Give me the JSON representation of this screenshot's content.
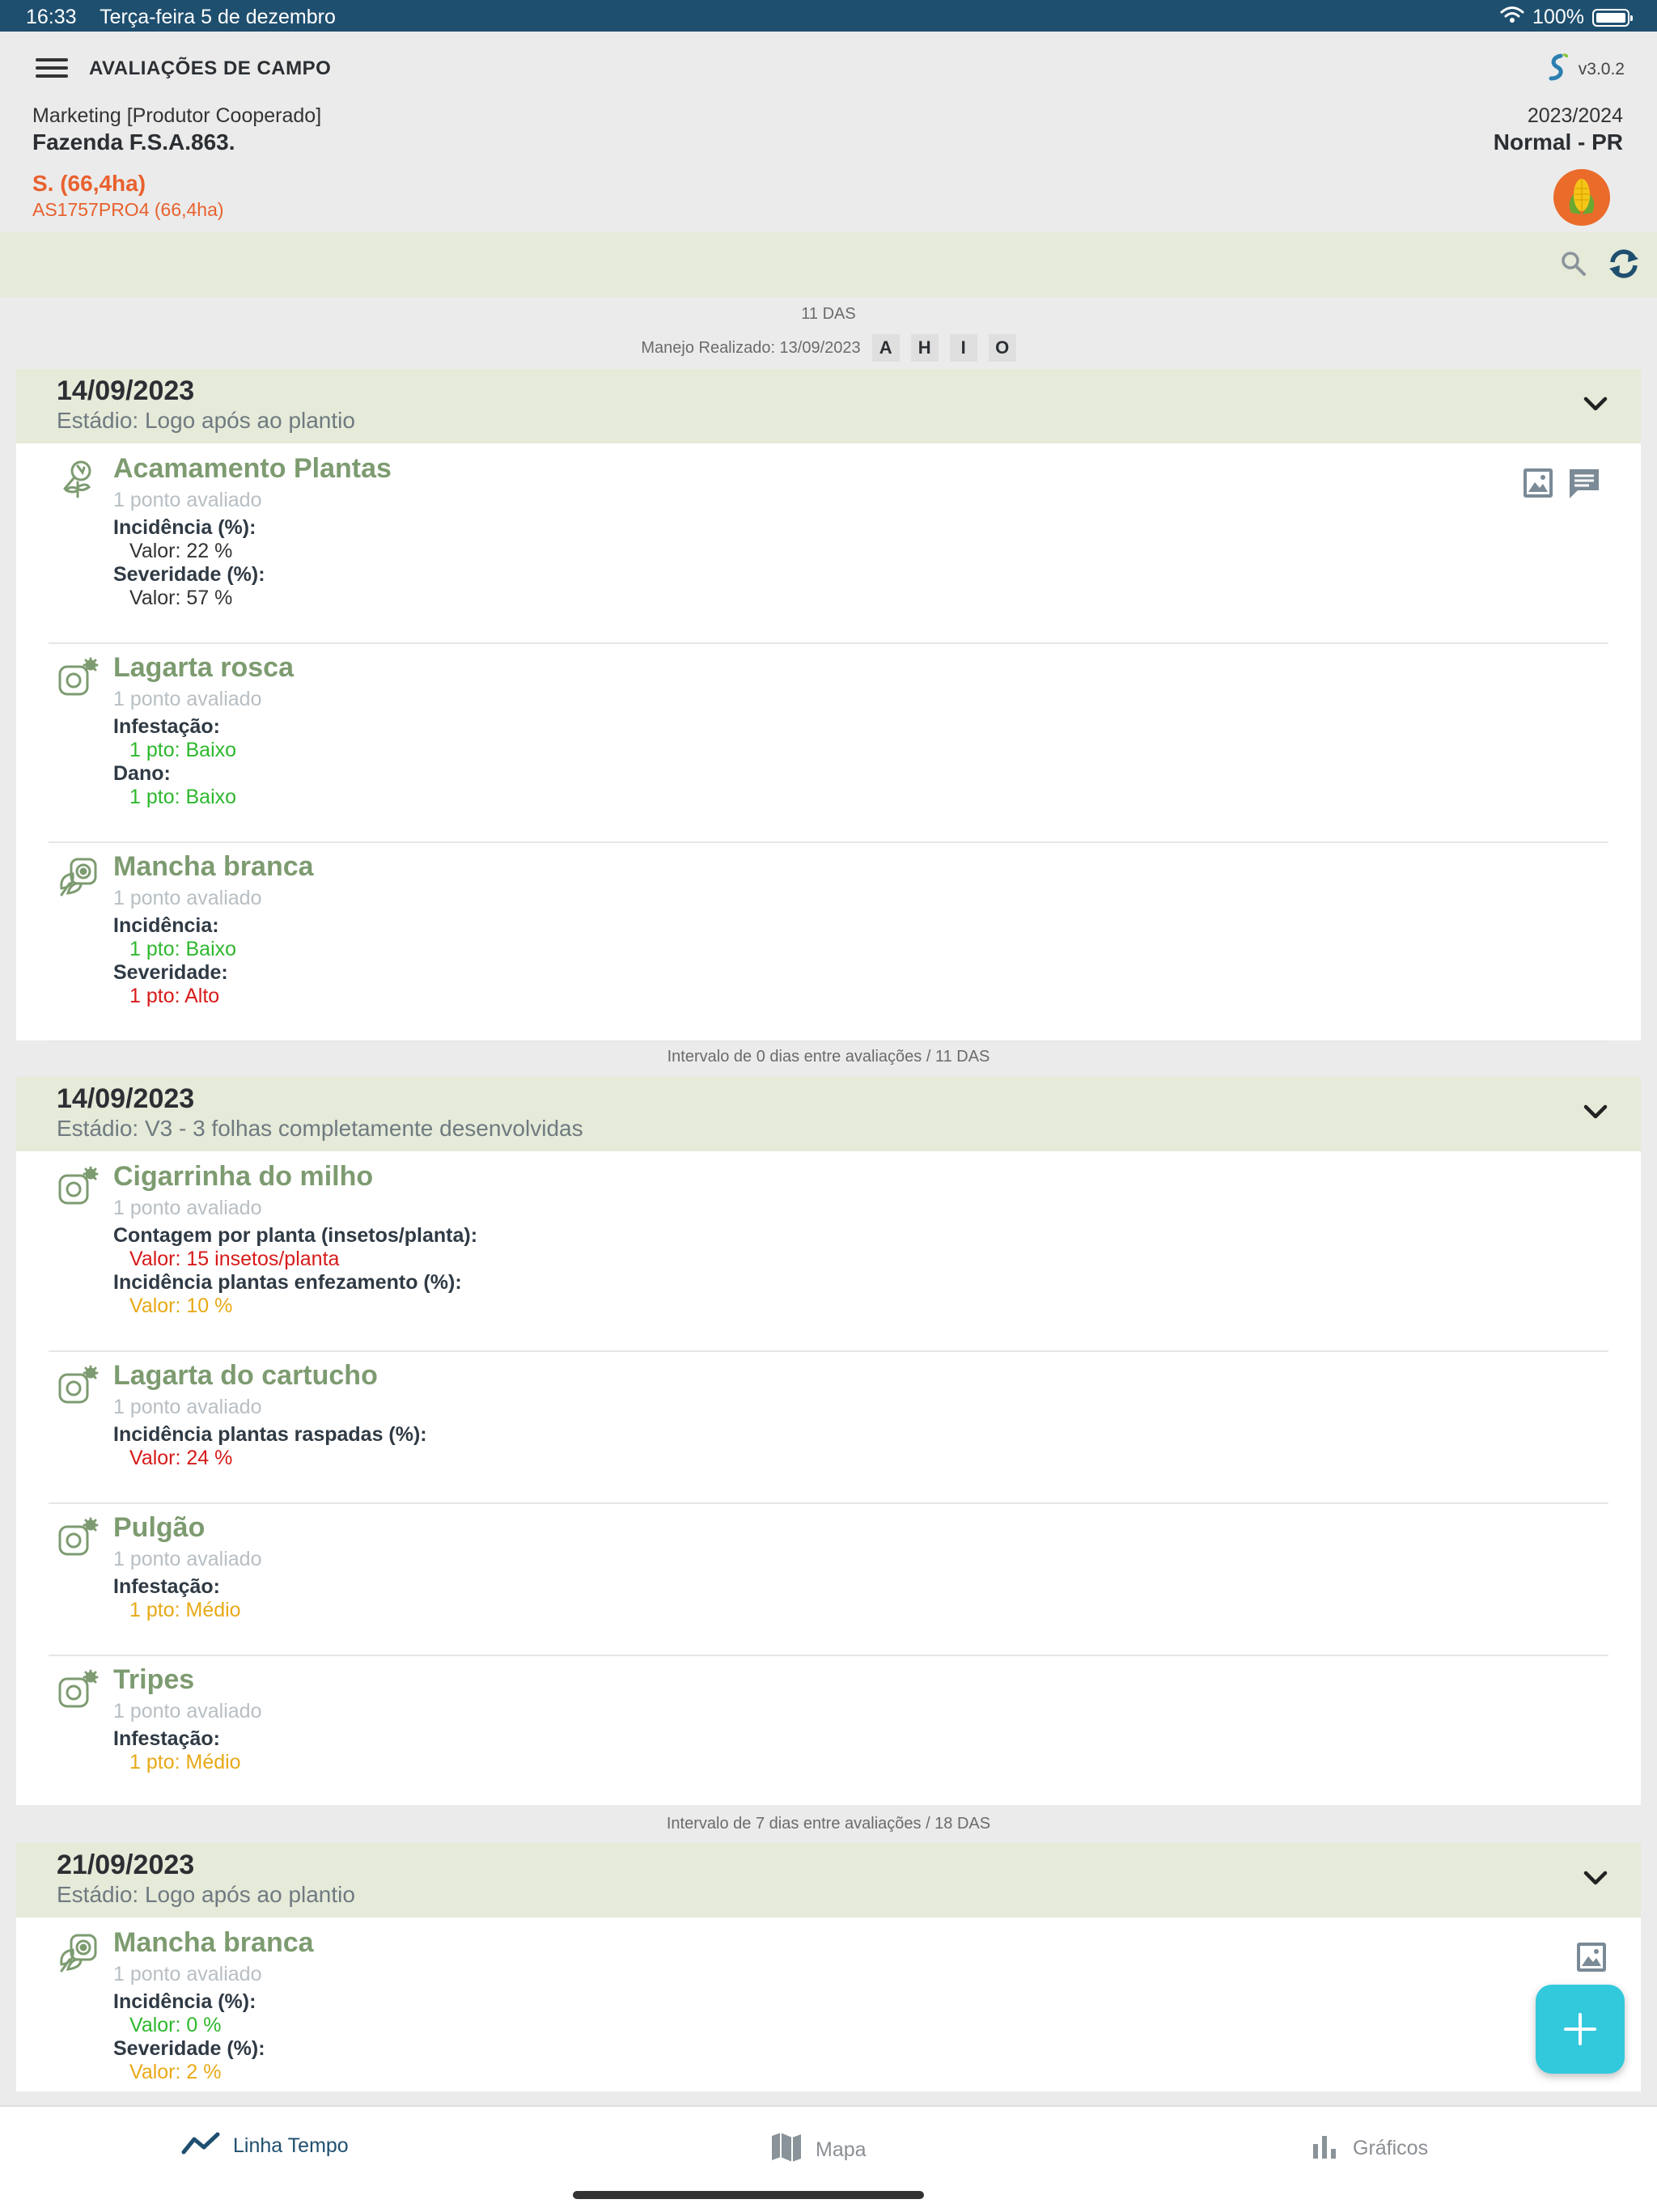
{
  "status_bar": {
    "time": "16:33",
    "date": "Terça-feira 5 de dezembro",
    "battery": "100%",
    "icons": [
      "wifi-icon",
      "battery-icon"
    ]
  },
  "header": {
    "title": "AVALIAÇÕES DE CAMPO",
    "version": "v3.0.2",
    "producer": "Marketing [Produtor Cooperado]",
    "farm": "Fazenda F.S.A.863.",
    "season": "2023/2024",
    "harvest": "Normal - PR",
    "field": "S. (66,4ha)",
    "variety": "AS1757PRO4 (66,4ha)",
    "icons": [
      "menu-icon",
      "brand-logo-icon",
      "corn-icon"
    ]
  },
  "toolbar": {
    "icons": [
      "search-icon",
      "refresh-icon"
    ]
  },
  "timeline": {
    "das_top": "11 DAS",
    "manejo": "Manejo Realizado: 13/09/2023",
    "manejo_badges": [
      "A",
      "H",
      "I",
      "O"
    ],
    "groups": [
      {
        "date": "14/09/2023",
        "stage": "Estádio: Logo após ao plantio",
        "cards": [
          {
            "name": "Acamamento Plantas",
            "points": "1 ponto avaliado",
            "icon": "plant-lodging-icon",
            "actions": [
              "image-icon",
              "comment-icon"
            ],
            "rows": [
              {
                "attr": "Incidência (%):",
                "value": "Valor: 22 %",
                "color": "#333333"
              },
              {
                "attr": "Severidade (%):",
                "value": "Valor: 57 %",
                "color": "#333333"
              }
            ]
          },
          {
            "name": "Lagarta rosca",
            "points": "1 ponto avaliado",
            "icon": "pest-trap-icon",
            "rows": [
              {
                "attr": "Infestação:",
                "value": "1 pto: Baixo",
                "color": "#2db82d"
              },
              {
                "attr": "Dano:",
                "value": "1 pto: Baixo",
                "color": "#2db82d"
              }
            ]
          },
          {
            "name": "Mancha branca",
            "points": "1 ponto avaliado",
            "icon": "leaf-disease-icon",
            "rows": [
              {
                "attr": "Incidência:",
                "value": "1 pto: Baixo",
                "color": "#2db82d"
              },
              {
                "attr": "Severidade:",
                "value": "1 pto: Alto",
                "color": "#d71a1a"
              }
            ]
          }
        ]
      },
      {
        "interval": "Intervalo de 0 dias entre avaliações  / 11 DAS",
        "date": "14/09/2023",
        "stage": "Estádio: V3 - 3 folhas completamente desenvolvidas",
        "cards": [
          {
            "name": "Cigarrinha do milho",
            "points": "1 ponto avaliado",
            "icon": "pest-trap-icon",
            "rows": [
              {
                "attr": "Contagem por planta (insetos/planta):",
                "value": "Valor: 15 insetos/planta",
                "color": "#d71a1a"
              },
              {
                "attr": "Incidência plantas enfezamento (%):",
                "value": "Valor: 10 %",
                "color": "#e8a917"
              }
            ]
          },
          {
            "name": "Lagarta do cartucho",
            "points": "1 ponto avaliado",
            "icon": "pest-trap-icon",
            "rows": [
              {
                "attr": "Incidência plantas raspadas (%):",
                "value": "Valor: 24 %",
                "color": "#d71a1a"
              }
            ]
          },
          {
            "name": "Pulgão",
            "points": "1 ponto avaliado",
            "icon": "pest-trap-icon",
            "rows": [
              {
                "attr": "Infestação:",
                "value": "1 pto: Médio",
                "color": "#e8a917"
              }
            ]
          },
          {
            "name": "Tripes",
            "points": "1 ponto avaliado",
            "icon": "pest-trap-icon",
            "rows": [
              {
                "attr": "Infestação:",
                "value": "1 pto: Médio",
                "color": "#e8a917"
              }
            ]
          }
        ]
      },
      {
        "interval": "Intervalo de 7 dias entre avaliações  / 18 DAS",
        "date": "21/09/2023",
        "stage": "Estádio: Logo após ao plantio",
        "cards": [
          {
            "name": "Mancha branca",
            "points": "1 ponto avaliado",
            "icon": "leaf-disease-icon",
            "actions": [
              "image-icon"
            ],
            "rows": [
              {
                "attr": "Incidência (%):",
                "value": "Valor: 0 %",
                "color": "#2db82d"
              },
              {
                "attr": "Severidade (%):",
                "value": "Valor: 2 %",
                "color": "#e8a917"
              }
            ]
          }
        ]
      }
    ]
  },
  "fab": {
    "icon": "plus-icon"
  },
  "bottom_nav": {
    "items": [
      {
        "label": "Linha Tempo",
        "icon": "timeline-icon",
        "active": true
      },
      {
        "label": "Mapa",
        "icon": "map-icon",
        "active": false
      },
      {
        "label": "Gráficos",
        "icon": "bar-chart-icon",
        "active": false
      }
    ]
  },
  "colors": {
    "status_bar": "#1f4f6f",
    "accent_orange": "#e8612e",
    "card_title_green": "#7d9b70",
    "group_header_bg": "#e5ead9",
    "value_green": "#2db82d",
    "value_red": "#d71a1a",
    "value_amber": "#e8a917",
    "fab": "#33c9dc"
  }
}
